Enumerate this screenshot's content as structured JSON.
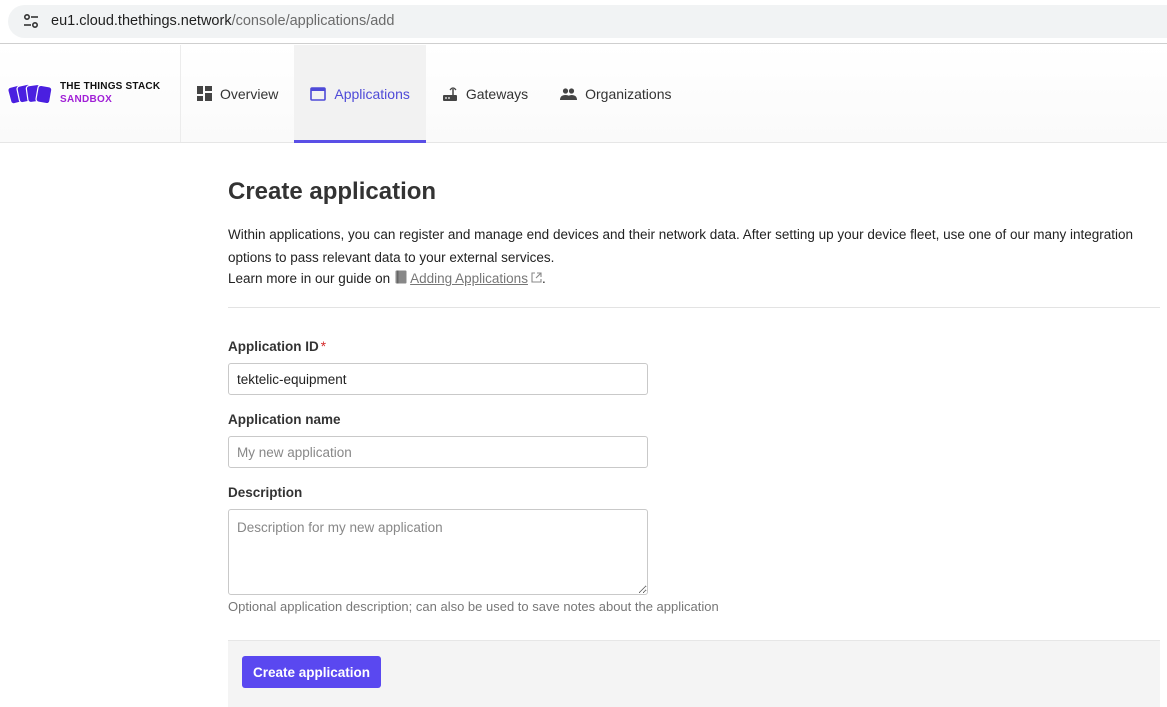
{
  "browser": {
    "url_host": "eu1.cloud.thethings.network",
    "url_path": "/console/applications/add"
  },
  "brand": {
    "line1": "THE THINGS STACK",
    "line2": "SANDBOX"
  },
  "nav": {
    "items": [
      {
        "label": "Overview",
        "icon": "dashboard-icon"
      },
      {
        "label": "Applications",
        "icon": "application-window-icon",
        "active": true
      },
      {
        "label": "Gateways",
        "icon": "gateway-router-icon"
      },
      {
        "label": "Organizations",
        "icon": "people-icon"
      }
    ]
  },
  "page": {
    "title": "Create application",
    "description": "Within applications, you can register and manage end devices and their network data. After setting up your device fleet, use one of our many integration options to pass relevant data to your external services.",
    "learn_prefix": "Learn more in our guide on",
    "learn_link": "Adding Applications",
    "learn_suffix": "."
  },
  "form": {
    "app_id": {
      "label": "Application ID",
      "required_mark": "*",
      "value": "tektelic-equipment"
    },
    "app_name": {
      "label": "Application name",
      "placeholder": "My new application"
    },
    "description": {
      "label": "Description",
      "placeholder": "Description for my new application",
      "helper": "Optional application description; can also be used to save notes about the application"
    },
    "submit_label": "Create application"
  },
  "colors": {
    "accent": "#5a48f0",
    "brand_purple": "#a01fd6",
    "required": "#d42a2a"
  }
}
